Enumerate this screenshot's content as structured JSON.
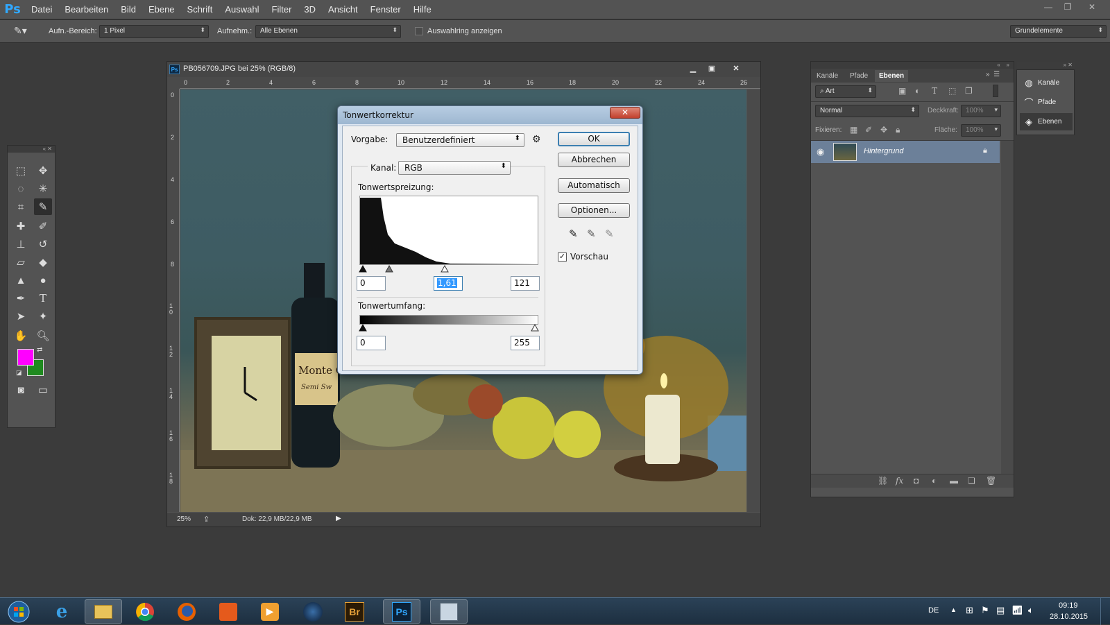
{
  "app": {
    "logo": "Ps",
    "menu": [
      "Datei",
      "Bearbeiten",
      "Bild",
      "Ebene",
      "Schrift",
      "Auswahl",
      "Filter",
      "3D",
      "Ansicht",
      "Fenster",
      "Hilfe"
    ]
  },
  "options_bar": {
    "sample_size_label": "Aufn.-Bereich:",
    "sample_size_value": "1 Pixel",
    "sample_label": "Aufnehm.:",
    "sample_value": "Alle Ebenen",
    "show_ring_label": "Auswahlring anzeigen",
    "workspace": "Grundelemente"
  },
  "document": {
    "title": "PB056709.JPG bei 25% (RGB/8)",
    "ruler_top": [
      "0",
      "2",
      "4",
      "6",
      "8",
      "10",
      "12",
      "14",
      "16",
      "18",
      "20",
      "22",
      "24",
      "26"
    ],
    "ruler_left": [
      "0",
      "2",
      "4",
      "6",
      "8",
      "10",
      "12",
      "14",
      "16",
      "18"
    ],
    "zoom": "25%",
    "doc_size": "Dok: 22,9 MB/22,9 MB",
    "image_labels": {
      "bottle_label": "Monte C",
      "bottle_sublabel": "Semi Sw"
    }
  },
  "dialog": {
    "title": "Tonwertkorrektur",
    "preset_label": "Vorgabe:",
    "preset_value": "Benutzerdefiniert",
    "channel_label": "Kanal:",
    "channel_value": "RGB",
    "input_levels_label": "Tonwertspreizung:",
    "input_black": "0",
    "input_gamma": "1,61",
    "input_white": "121",
    "output_levels_label": "Tonwertumfang:",
    "output_black": "0",
    "output_white": "255",
    "buttons": {
      "ok": "OK",
      "cancel": "Abbrechen",
      "auto": "Automatisch",
      "options": "Optionen..."
    },
    "preview_label": "Vorschau",
    "preview_checked": true
  },
  "layers_panel": {
    "tabs": [
      "Kanäle",
      "Pfade",
      "Ebenen"
    ],
    "active_tab": "Ebenen",
    "filter_kind": "Art",
    "blend_mode": "Normal",
    "opacity_label": "Deckkraft:",
    "opacity_value": "100%",
    "lock_label": "Fixieren:",
    "fill_label": "Fläche:",
    "fill_value": "100%",
    "layers": [
      {
        "name": "Hintergrund",
        "locked": true,
        "visible": true
      }
    ]
  },
  "side_dock": {
    "items": [
      "Kanäle",
      "Pfade",
      "Ebenen"
    ]
  },
  "colors": {
    "foreground": "#ff00ff",
    "background": "#1f8a1f"
  },
  "taskbar": {
    "language": "DE",
    "time": "09:19",
    "date": "28.10.2015",
    "apps": [
      "start-icon",
      "internet-explorer-icon",
      "file-explorer-icon",
      "chrome-icon",
      "firefox-icon",
      "office-icon",
      "media-player-icon",
      "globe-icon",
      "bridge-icon",
      "photoshop-icon",
      "calculator-icon"
    ],
    "bridge_label": "Br",
    "photoshop_label": "Ps"
  }
}
